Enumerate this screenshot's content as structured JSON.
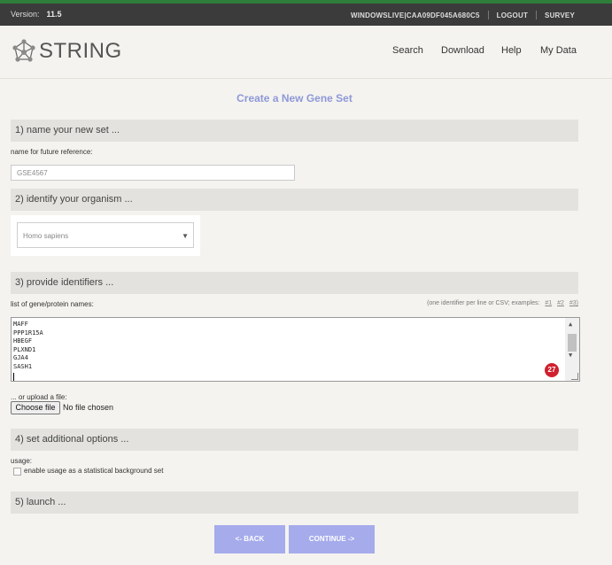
{
  "topbar": {
    "version_label": "Version:",
    "version_value": "11.5",
    "account": "WINDOWSLIVE|CAA09DF045A680C5",
    "logout": "LOGOUT",
    "survey": "SURVEY"
  },
  "header": {
    "logo_text": "STRING",
    "nav": [
      "Search",
      "Download",
      "Help",
      "My Data"
    ]
  },
  "page": {
    "title": "Create a New Gene Set"
  },
  "step1": {
    "heading": "1) name your new set ...",
    "field_label": "name for future reference:",
    "value": "GSE4567"
  },
  "step2": {
    "heading": "2) identify your organism ...",
    "selected": "Homo sapiens"
  },
  "step3": {
    "heading": "3) provide identifiers ...",
    "list_label": "list of gene/protein names:",
    "hint": "(one identifier per line or CSV; examples:",
    "examples": [
      "#1",
      "#2",
      "#3)"
    ],
    "identifiers": [
      "MAFF",
      "PPP1R15A",
      "HBEGF",
      "PLXND1",
      "GJA4",
      "SASH1"
    ],
    "count_badge": "27",
    "upload_label": "... or upload a file:",
    "choose_file": "Choose file",
    "no_file": "No file chosen"
  },
  "step4": {
    "heading": "4) set additional options ...",
    "usage_label": "usage:",
    "checkbox_label": "enable usage as a statistical background set",
    "checked": false
  },
  "step5": {
    "heading": "5) launch ..."
  },
  "buttons": {
    "back": "<- BACK",
    "continue": "CONTINUE ->"
  },
  "colors": {
    "accent": "#8e98d8",
    "button": "#a5abeb",
    "topbar": "#3b3b3b",
    "badge": "#d0202f"
  }
}
